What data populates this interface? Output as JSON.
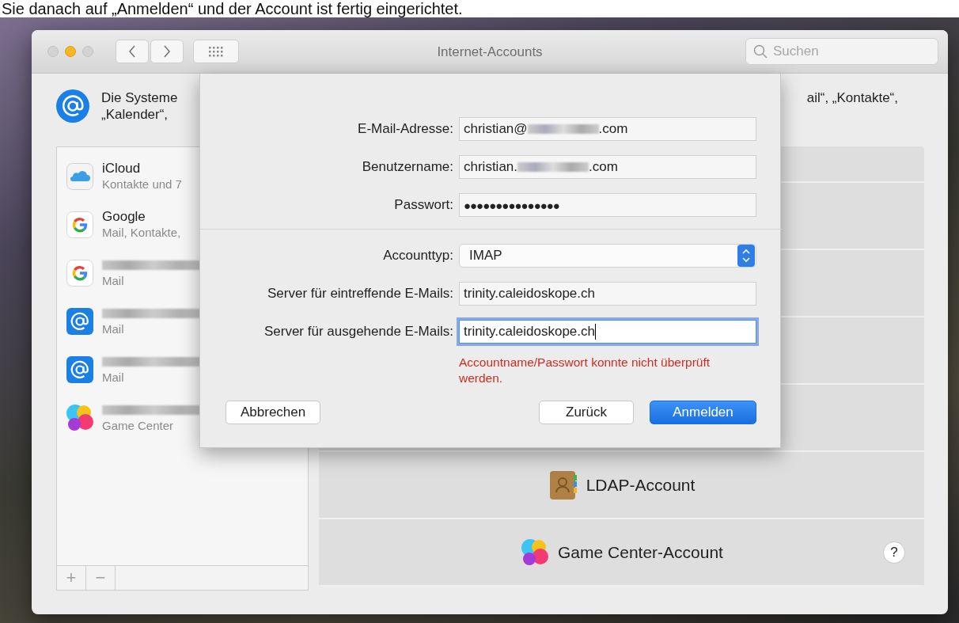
{
  "caption": "Sie danach auf „Anmelden“ und der Account ist fertig eingerichtet.",
  "window": {
    "title": "Internet-Accounts",
    "search": {
      "placeholder": "Suchen"
    }
  },
  "header": {
    "text_left": [
      "Die Systeme",
      "„Kalender“,"
    ],
    "text_right": "ail“, „Kontakte“,"
  },
  "accounts": [
    {
      "name": "iCloud",
      "detail": "Kontakte und 7",
      "kind": "icloud"
    },
    {
      "name": "Google",
      "detail": "Mail, Kontakte,",
      "kind": "google"
    },
    {
      "detail": "Mail",
      "kind": "google"
    },
    {
      "detail": "Mail",
      "kind": "mail"
    },
    {
      "detail": "Mail",
      "kind": "mail"
    },
    {
      "detail": "Game Center",
      "kind": "gamecenter"
    }
  ],
  "sidebar_buttons": [
    "+",
    "−"
  ],
  "providers": [
    {
      "label": "LDAP-Account",
      "kind": "ldap"
    },
    {
      "label": "Game Center-Account",
      "kind": "gamecenter"
    }
  ],
  "help_button": "?",
  "sheet": {
    "fields": [
      {
        "label": "E-Mail-Adresse:",
        "value": "christian@",
        "value_end": ".com",
        "kind": "text",
        "focused": false
      },
      {
        "label": "Benutzername:",
        "value": "christian.",
        "value_end": ".com",
        "kind": "text",
        "focused": false
      },
      {
        "label": "Passwort:",
        "value": "●●●●●●●●●●●●●●●",
        "kind": "password",
        "focused": false
      },
      {
        "kind": "divider"
      },
      {
        "label": "Accounttyp:",
        "value": "IMAP",
        "kind": "popup",
        "focused": false
      },
      {
        "label": "Server für eintreffende E-Mails:",
        "value": "trinity.caleidoskope.ch",
        "kind": "text",
        "focused": false
      },
      {
        "label": "Server für ausgehende E-Mails:",
        "value": "trinity.caleidoskope.ch",
        "kind": "text",
        "focused": true
      }
    ],
    "error": "Accountname/Passwort konnte nicht überprüft werden.",
    "buttons": [
      {
        "label": "Abbrechen",
        "default": false
      },
      {
        "label": "Zurück",
        "default": false
      },
      {
        "label": "Anmelden",
        "default": true
      }
    ]
  }
}
